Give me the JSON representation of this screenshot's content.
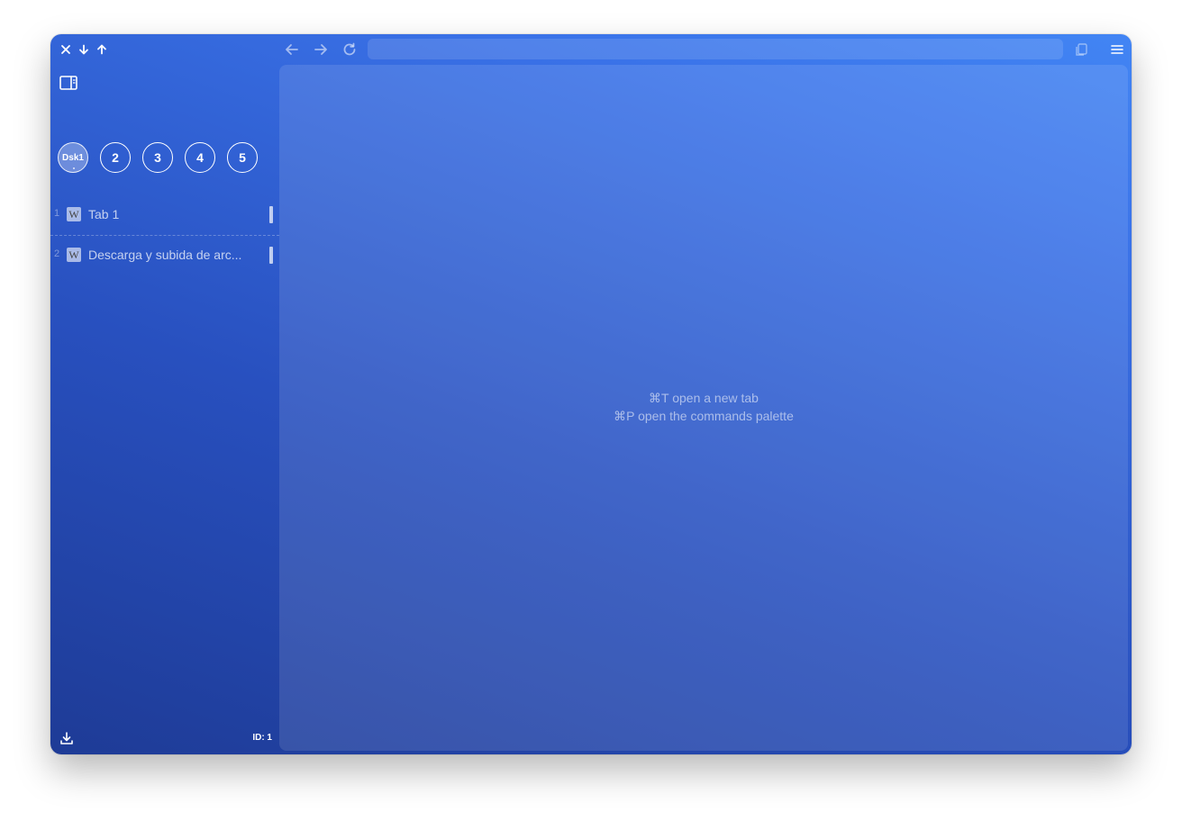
{
  "titlebar": {
    "window_controls": [
      {
        "icon": "close-icon"
      },
      {
        "icon": "arrow-down-icon"
      },
      {
        "icon": "arrow-up-icon"
      }
    ],
    "nav": [
      {
        "icon": "back-arrow-icon"
      },
      {
        "icon": "forward-arrow-icon"
      },
      {
        "icon": "reload-icon"
      }
    ],
    "address_value": "",
    "right": [
      {
        "icon": "copy-icon"
      },
      {
        "icon": "menu-icon"
      }
    ]
  },
  "sidebar": {
    "toggle_icon": "sidebar-toggle-icon",
    "desktops": [
      {
        "label": "Dsk1",
        "active": true
      },
      {
        "label": "2",
        "active": false
      },
      {
        "label": "3",
        "active": false
      },
      {
        "label": "4",
        "active": false
      },
      {
        "label": "5",
        "active": false
      }
    ],
    "tabs": [
      {
        "number": "1",
        "favicon": "W",
        "title": "Tab 1"
      },
      {
        "number": "2",
        "favicon": "W",
        "title": "Descarga y subida de arc..."
      }
    ],
    "footer": {
      "download_icon": "download-icon",
      "window_id": "ID: 1"
    }
  },
  "content": {
    "hints": [
      "⌘T open a new tab",
      "⌘P open the commands palette"
    ]
  },
  "colors": {
    "gradient_start": "#1e3b96",
    "gradient_end": "#4285f4",
    "text": "#ffffff"
  }
}
